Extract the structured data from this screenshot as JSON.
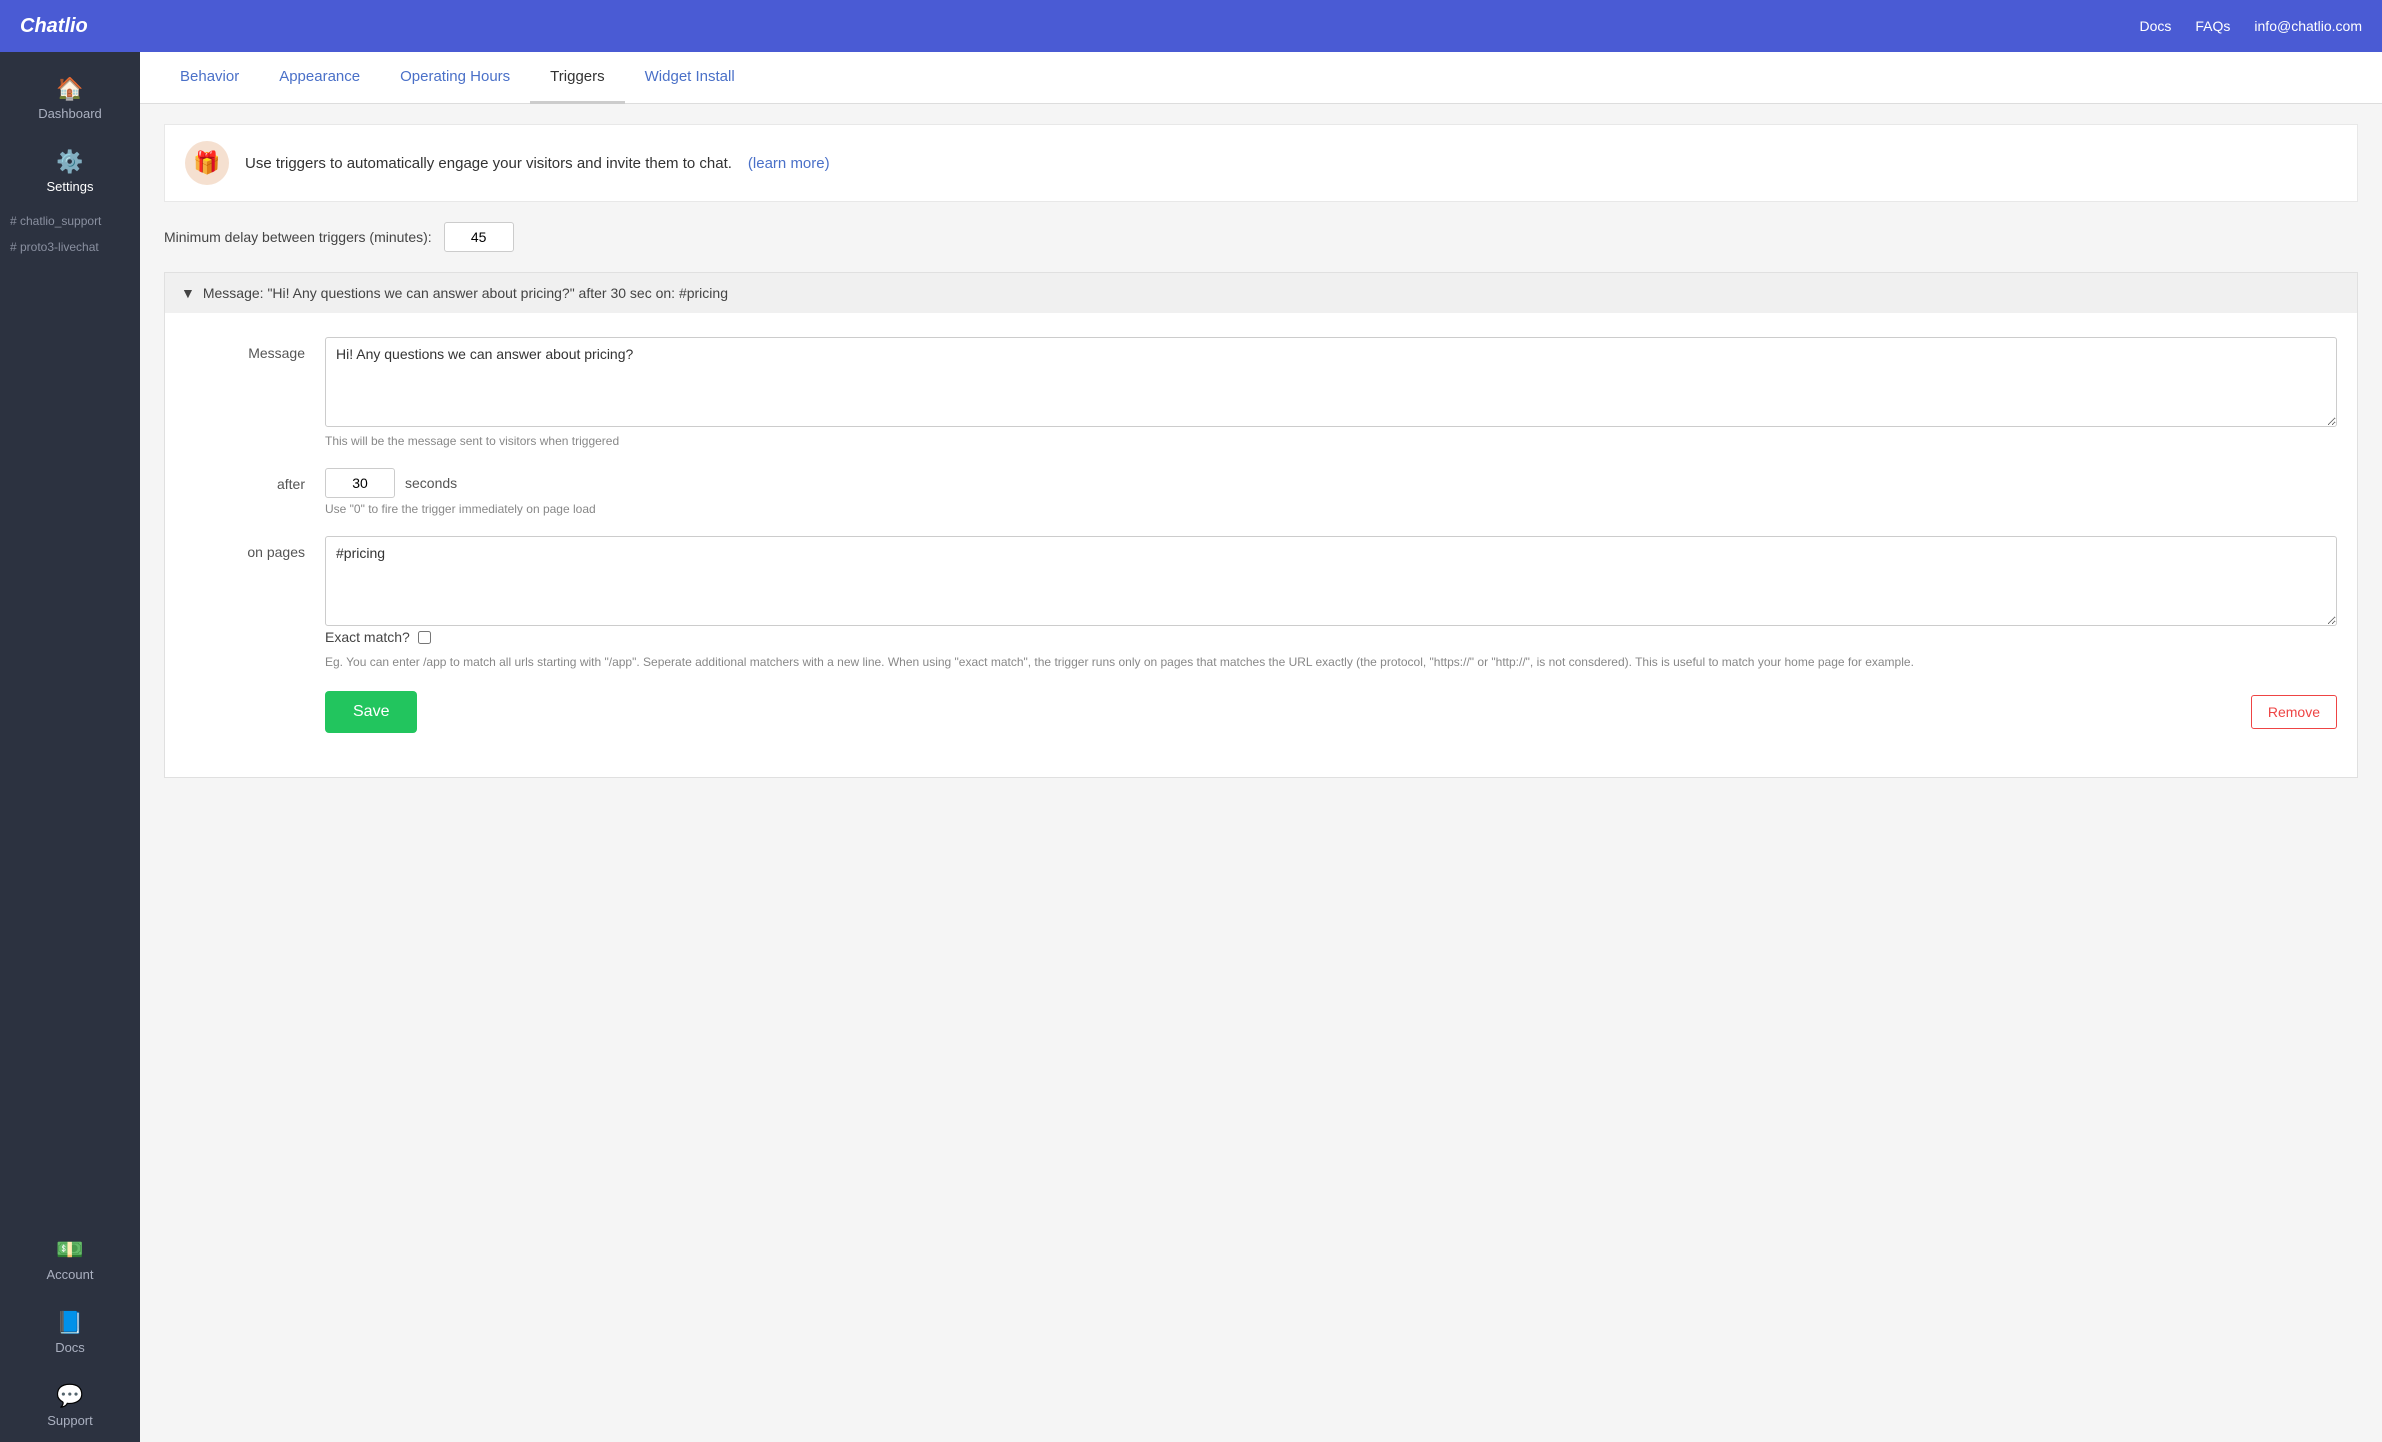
{
  "topNav": {
    "logo": "Chatlio",
    "links": [
      "Docs",
      "FAQs",
      "info@chatlio.com"
    ]
  },
  "sidebar": {
    "items": [
      {
        "id": "dashboard",
        "label": "Dashboard",
        "icon": "🏠"
      },
      {
        "id": "settings",
        "label": "Settings",
        "icon": "⚙️",
        "active": true
      }
    ],
    "channels": [
      {
        "label": "# chatlio_support"
      },
      {
        "label": "# proto3-livechat"
      }
    ],
    "bottomItems": [
      {
        "id": "account",
        "label": "Account",
        "icon": "💵"
      },
      {
        "id": "docs",
        "label": "Docs",
        "icon": "📘"
      },
      {
        "id": "support",
        "label": "Support",
        "icon": "💬"
      }
    ]
  },
  "tabs": [
    {
      "id": "behavior",
      "label": "Behavior",
      "active": false
    },
    {
      "id": "appearance",
      "label": "Appearance",
      "active": false
    },
    {
      "id": "operating-hours",
      "label": "Operating Hours",
      "active": false
    },
    {
      "id": "triggers",
      "label": "Triggers",
      "active": true
    },
    {
      "id": "widget-install",
      "label": "Widget Install",
      "active": false
    }
  ],
  "infoBanner": {
    "icon": "🎁",
    "text": "Use triggers to automatically engage your visitors and invite them to chat.",
    "learnMore": "(learn more)"
  },
  "delayRow": {
    "label": "Minimum delay between triggers (minutes):",
    "value": "45"
  },
  "triggerCard": {
    "headerText": "Message: \"Hi! Any questions we can answer about pricing?\" after 30 sec on: #pricing",
    "collapseIcon": "▼",
    "messageLabel": "Message",
    "messageValue": "Hi! Any questions we can answer about pricing?",
    "messageHint": "This will be the message sent to visitors when triggered",
    "afterLabel": "after",
    "afterValue": "30",
    "secondsLabel": "seconds",
    "afterHint": "Use \"0\" to fire the trigger immediately on page load",
    "onPagesLabel": "on pages",
    "onPagesValue": "#pricing",
    "exactMatchLabel": "Exact match?",
    "egText": "Eg. You can enter /app to match all urls starting with \"/app\". Seperate additional matchers with a new line. When using \"exact match\", the trigger runs only on pages that matches the URL exactly (the protocol, \"https://\" or \"http://\", is not consdered). This is useful to match your home page for example.",
    "saveLabel": "Save",
    "removeLabel": "Remove"
  }
}
